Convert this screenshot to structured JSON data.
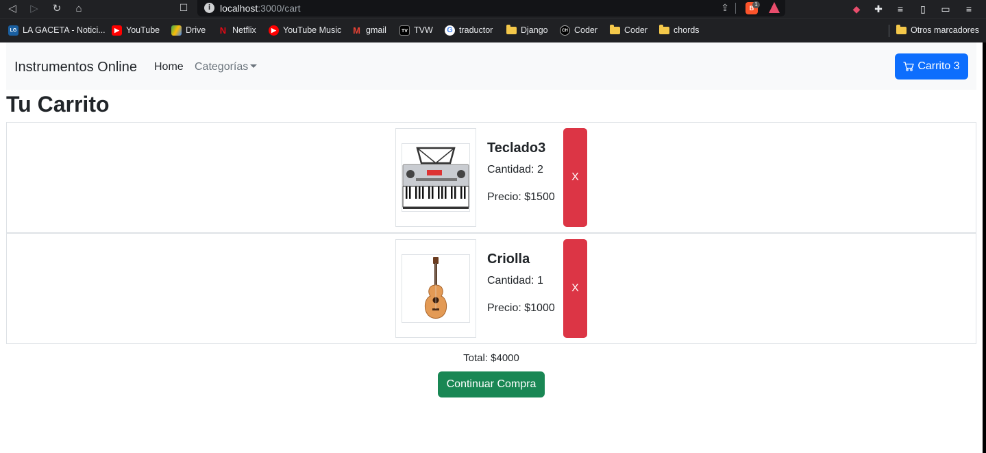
{
  "browser": {
    "url_host": "localhost",
    "url_path": ":3000/cart",
    "brave_badge": "1"
  },
  "bookmarks": [
    {
      "label": "LA GACETA - Notici...",
      "icon": "la-gaceta-icon",
      "color": "#1a5fa0"
    },
    {
      "label": "YouTube",
      "icon": "youtube-icon",
      "color": "#ff0000"
    },
    {
      "label": "Drive",
      "icon": "drive-icon",
      "color": "#34a853"
    },
    {
      "label": "Netflix",
      "icon": "netflix-icon",
      "color": "#e50914"
    },
    {
      "label": "YouTube Music",
      "icon": "youtube-music-icon",
      "color": "#ff0000"
    },
    {
      "label": "gmail",
      "icon": "gmail-icon",
      "color": "#ea4335"
    },
    {
      "label": "TVW",
      "icon": "tvw-icon",
      "color": "#000000"
    },
    {
      "label": "traductor",
      "icon": "google-icon",
      "color": "#ffffff"
    },
    {
      "label": "Django",
      "icon": "folder-icon",
      "color": "#f4c84a"
    },
    {
      "label": "Coder",
      "icon": "coder-icon",
      "color": "#000000"
    },
    {
      "label": "Coder",
      "icon": "folder-icon",
      "color": "#f4c84a"
    },
    {
      "label": "chords",
      "icon": "folder-icon",
      "color": "#f4c84a"
    }
  ],
  "other_bookmarks": "Otros marcadores",
  "navbar": {
    "brand": "Instrumentos Online",
    "home": "Home",
    "categories": "Categorías",
    "cart_label": "Carrito 3"
  },
  "page_title": "Tu Carrito",
  "items": [
    {
      "name": "Teclado3",
      "quantity": "Cantidad: 2",
      "price": "Precio: $1500",
      "remove": "X",
      "image": "keyboard-image"
    },
    {
      "name": "Criolla",
      "quantity": "Cantidad: 1",
      "price": "Precio: $1000",
      "remove": "X",
      "image": "guitar-image"
    }
  ],
  "total": "Total: $4000",
  "checkout_label": "Continuar Compra",
  "colors": {
    "primary": "#0d6efd",
    "danger": "#dc3545",
    "success": "#198754"
  }
}
